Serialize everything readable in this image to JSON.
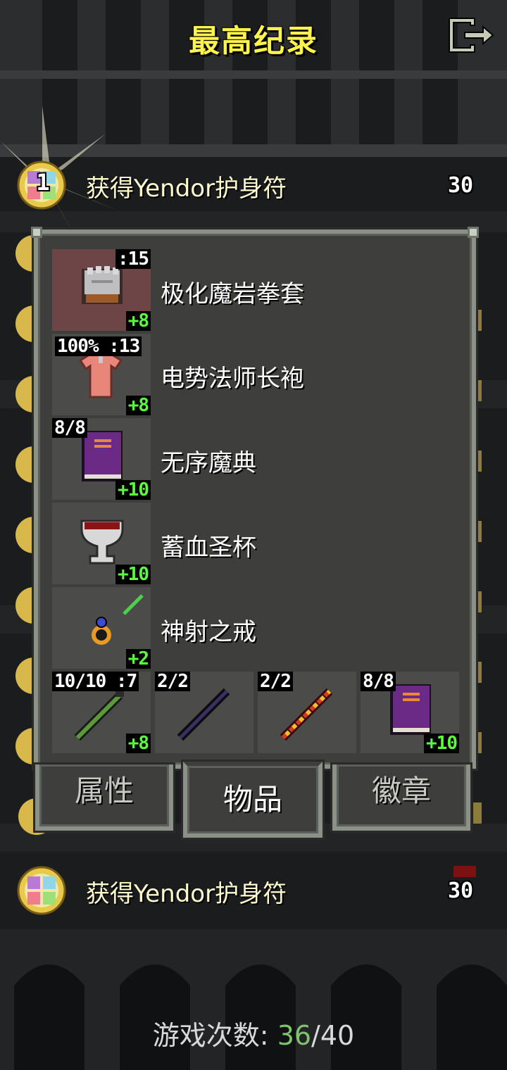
{
  "header": {
    "title": "最高纪录",
    "exit_icon": "exit-door-icon"
  },
  "records": [
    {
      "rank": "1",
      "text": "获得Yendor护身符",
      "level": "30",
      "medal_icon": "amulet-of-yendor-icon"
    },
    {
      "rank": "",
      "text": "获得Yendor护身符",
      "level": "30",
      "medal_icon": "amulet-of-yendor-icon"
    }
  ],
  "panel": {
    "items": [
      {
        "name": "极化魔岩拳套",
        "icon": "gauntlet-icon",
        "top_badge": ":15",
        "bottom_badge": "+8",
        "equipped": true
      },
      {
        "name": "电势法师长袍",
        "icon": "robe-icon",
        "top_badge": "100% :13",
        "bottom_badge": "+8",
        "equipped": false
      },
      {
        "name": "无序魔典",
        "icon": "spellbook-icon",
        "top_badge": "8/8",
        "bottom_badge": "+10",
        "equipped": false
      },
      {
        "name": "蓄血圣杯",
        "icon": "chalice-icon",
        "top_badge": "",
        "bottom_badge": "+10",
        "equipped": false
      },
      {
        "name": "神射之戒",
        "icon": "ring-icon",
        "top_badge": "",
        "bottom_badge": "+2",
        "equipped": false
      }
    ],
    "quickslots": [
      {
        "icon": "green-wand-icon",
        "top_badge": "10/10 :7",
        "bottom_badge": "+8"
      },
      {
        "icon": "dark-wand-icon",
        "top_badge": "2/2",
        "bottom_badge": ""
      },
      {
        "icon": "red-wand-icon",
        "top_badge": "2/2",
        "bottom_badge": ""
      },
      {
        "icon": "spellbook-icon",
        "top_badge": "8/8",
        "bottom_badge": "+10"
      }
    ]
  },
  "tabs": [
    {
      "label": "属性",
      "active": false
    },
    {
      "label": "物品",
      "active": true
    },
    {
      "label": "徽章",
      "active": false
    }
  ],
  "footer": {
    "label": "游戏次数:",
    "current": "36",
    "separator": "/",
    "total": "40"
  },
  "colors": {
    "title": "#fff44d",
    "badge_green": "#5bff3b",
    "played_count": "#7ec36d",
    "equipped_slot": "#6e4546"
  }
}
